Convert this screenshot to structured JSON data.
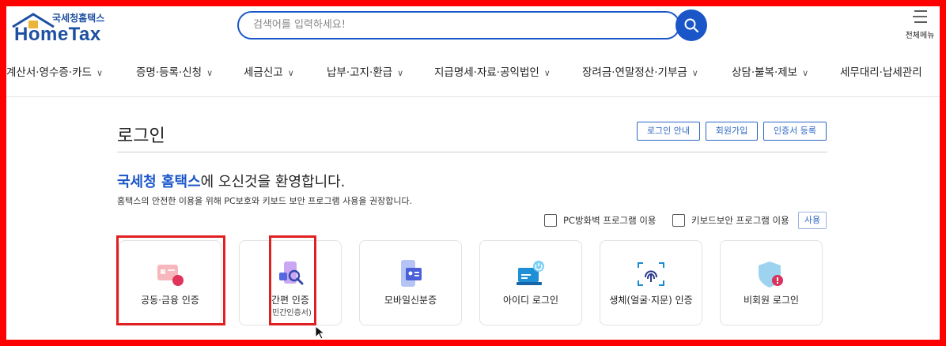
{
  "header": {
    "logo_sub": "국세청홈택스",
    "logo_main": "HomeTax",
    "search_placeholder": "검색어를 입력하세요!",
    "all_menu_label": "전체메뉴"
  },
  "nav": {
    "items": [
      "계산서·영수증·카드",
      "증명·등록·신청",
      "세금신고",
      "납부·고지·환급",
      "지급명세·자료·공익법인",
      "장려금·연말정산·기부금",
      "상담·불복·제보",
      "세무대리·납세관리"
    ]
  },
  "login": {
    "title": "로그인",
    "buttons": [
      "로그인 안내",
      "회원가입",
      "인증서 등록"
    ],
    "welcome_brand": "국세청 홈택스",
    "welcome_rest": "에 오신것을 환영합니다.",
    "notice": "홈택스의 안전한 이용을 위해 PC보호와 키보드 보안 프로그램 사용을 권장합니다.",
    "pc_firewall_label": "PC방화벽 프로그램 이용",
    "keyboard_security_label": "키보드보안 프로그램 이용",
    "use_button": "사용",
    "cards": [
      {
        "label": "공동·금융 인증",
        "sub": ""
      },
      {
        "label": "간편 인증",
        "sub": "(민간인증서)"
      },
      {
        "label": "모바일신분증",
        "sub": ""
      },
      {
        "label": "아이디 로그인",
        "sub": ""
      },
      {
        "label": "생체(얼굴·지문) 인증",
        "sub": ""
      },
      {
        "label": "비회원 로그인",
        "sub": ""
      }
    ]
  },
  "colors": {
    "brand_blue": "#1a56c8",
    "highlight_red": "#e02020",
    "frame_red": "#ff0000"
  }
}
